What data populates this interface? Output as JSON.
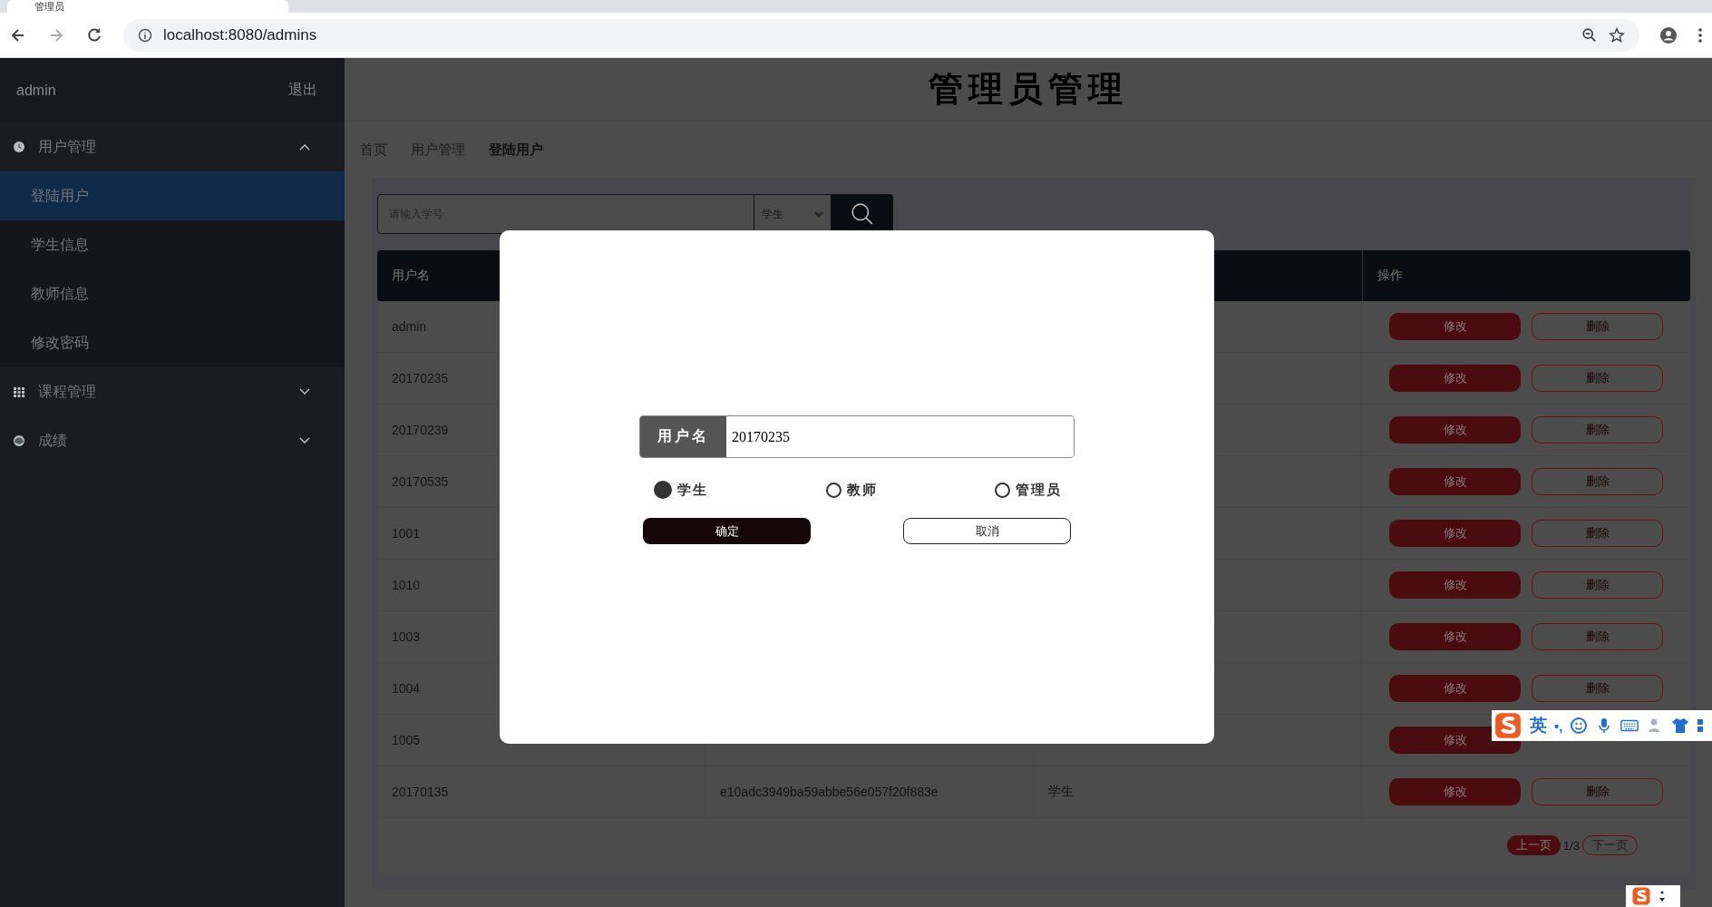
{
  "browser": {
    "tab_title": "管理员",
    "url": "localhost:8080/admins"
  },
  "sidebar": {
    "user": "admin",
    "logout": "退出",
    "groups": [
      {
        "label": "用户管理",
        "expanded": true,
        "children": [
          {
            "label": "登陆用户",
            "selected": true
          },
          {
            "label": "学生信息",
            "selected": false
          },
          {
            "label": "教师信息",
            "selected": false
          },
          {
            "label": "修改密码",
            "selected": false
          }
        ]
      },
      {
        "label": "课程管理",
        "expanded": false
      },
      {
        "label": "成绩",
        "expanded": false
      }
    ]
  },
  "page": {
    "title": "管理员管理",
    "breadcrumb": [
      {
        "label": "首页",
        "current": false
      },
      {
        "label": "用户管理",
        "current": false
      },
      {
        "label": "登陆用户",
        "current": true
      }
    ]
  },
  "search": {
    "placeholder": "请输入学号",
    "type": "学生"
  },
  "table": {
    "columns": {
      "username": "用户名",
      "actions": "操作"
    },
    "rows": [
      {
        "username": "admin",
        "edit": "修改",
        "delete": "删除"
      },
      {
        "username": "20170235",
        "edit": "修改",
        "delete": "删除"
      },
      {
        "username": "20170239",
        "edit": "修改",
        "delete": "删除"
      },
      {
        "username": "20170535",
        "edit": "修改",
        "delete": "删除"
      },
      {
        "username": "1001",
        "edit": "修改",
        "delete": "删除"
      },
      {
        "username": "1010",
        "edit": "修改",
        "delete": "删除"
      },
      {
        "username": "1003",
        "edit": "修改",
        "delete": "删除"
      },
      {
        "username": "1004",
        "edit": "修改",
        "delete": "删除"
      },
      {
        "username": "1005",
        "edit": "修改"
      },
      {
        "username": "20170135",
        "password": "e10adc3949ba59abbe56e057f20f883e",
        "type": "学生",
        "edit": "修改",
        "delete": "删除"
      }
    ]
  },
  "pagination": {
    "prev": "上一页",
    "page": "1/3",
    "next": "下一页"
  },
  "dialog": {
    "field_label": "用户名",
    "value": "20170235",
    "roles": [
      {
        "label": "学生",
        "selected": true
      },
      {
        "label": "教师",
        "selected": false
      },
      {
        "label": "管理员",
        "selected": false
      }
    ],
    "confirm": "确定",
    "cancel": "取消"
  },
  "ime": {
    "mode": "英",
    "punct": "•,"
  }
}
